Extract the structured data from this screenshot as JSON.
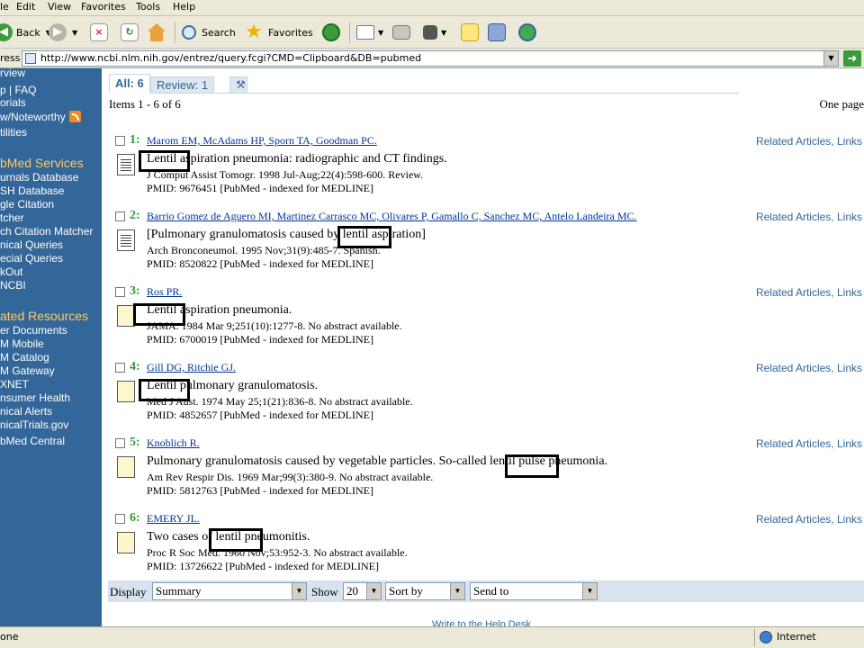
{
  "menu": [
    "le",
    "Edit",
    "View",
    "Favorites",
    "Tools",
    "Help"
  ],
  "toolbar": {
    "back": "Back",
    "search": "Search",
    "favorites": "Favorites"
  },
  "address": {
    "label": "ress",
    "url": "http://www.ncbi.nlm.nih.gov/entrez/query.fcgi?CMD=Clipboard&DB=pubmed"
  },
  "sidebar": {
    "items": [
      {
        "label": "rview",
        "type": "link"
      },
      {
        "label": "p | FAQ",
        "type": "link"
      },
      {
        "label": "orials",
        "type": "link"
      },
      {
        "label": "w/Noteworthy",
        "type": "link"
      },
      {
        "label": "tilities",
        "type": "link"
      },
      {
        "label": "bMed Services",
        "type": "header"
      },
      {
        "label": "urnals Database",
        "type": "link"
      },
      {
        "label": "SH Database",
        "type": "link"
      },
      {
        "label": "gle Citation",
        "type": "link"
      },
      {
        "label": "tcher",
        "type": "link"
      },
      {
        "label": "ch Citation Matcher",
        "type": "link"
      },
      {
        "label": "nical Queries",
        "type": "link"
      },
      {
        "label": "ecial Queries",
        "type": "link"
      },
      {
        "label": "kOut",
        "type": "link"
      },
      {
        "label": "NCBI",
        "type": "link"
      },
      {
        "label": "ated Resources",
        "type": "header"
      },
      {
        "label": "er Documents",
        "type": "link"
      },
      {
        "label": "M Mobile",
        "type": "link"
      },
      {
        "label": "M Catalog",
        "type": "link"
      },
      {
        "label": "M Gateway",
        "type": "link"
      },
      {
        "label": "XNET",
        "type": "link"
      },
      {
        "label": "nsumer Health",
        "type": "link"
      },
      {
        "label": "nical Alerts",
        "type": "link"
      },
      {
        "label": "nicalTrials.gov",
        "type": "link"
      },
      {
        "label": "bMed Central",
        "type": "link"
      }
    ]
  },
  "tabs": {
    "all": "All: 6",
    "review": "Review: 1"
  },
  "results": {
    "items_label": "Items 1 - 6 of 6",
    "page_label": "One page",
    "related_label": "Related Articles, Links",
    "records": [
      {
        "num": "1:",
        "authors": "Marom EM, McAdams HP, Sporn TA, Goodman PC.",
        "title": "Lentil aspiration pneumonia: radiographic and CT findings.",
        "source": "J Comput Assist Tomogr. 1998 Jul-Aug;22(4):598-600. Review.",
        "pmid": "PMID: 9676451 [PubMed - indexed for MEDLINE]",
        "icon": "abstract-icon"
      },
      {
        "num": "2:",
        "authors": "Barrio Gomez de Aguero MI, Martinez Carrasco MC, Olivares P, Gamallo C, Sanchez MC, Antelo Landeira MC.",
        "title": "[Pulmonary granulomatosis caused by lentil aspiration]",
        "source": "Arch Bronconeumol. 1995 Nov;31(9):485-7. Spanish.",
        "pmid": "PMID: 8520822 [PubMed - indexed for MEDLINE]",
        "icon": "abstract-icon"
      },
      {
        "num": "3:",
        "authors": "Ros PR.",
        "title": "Lentil aspiration pneumonia.",
        "source": "JAMA. 1984 Mar 9;251(10):1277-8. No abstract available.",
        "pmid": "PMID: 6700019 [PubMed - indexed for MEDLINE]",
        "icon": "no-abstract-icon"
      },
      {
        "num": "4:",
        "authors": "Gill DG, Ritchie GJ.",
        "title": "Lentil pulmonary granulomatosis.",
        "source": "Med J Aust. 1974 May 25;1(21):836-8. No abstract available.",
        "pmid": "PMID: 4852657 [PubMed - indexed for MEDLINE]",
        "icon": "no-abstract-icon"
      },
      {
        "num": "5:",
        "authors": "Knoblich R.",
        "title": "Pulmonary granulomatosis caused by vegetable particles. So-called lentil pulse pneumonia.",
        "source": "Am Rev Respir Dis. 1969 Mar;99(3):380-9. No abstract available.",
        "pmid": "PMID: 5812763 [PubMed - indexed for MEDLINE]",
        "icon": "no-abstract-icon"
      },
      {
        "num": "6:",
        "authors": "EMERY JL.",
        "title": "Two cases of lentil pneumonitis.",
        "source": "Proc R Soc Med. 1960 Nov;53:952-3. No abstract available.",
        "pmid": "PMID: 13726622 [PubMed - indexed for MEDLINE]",
        "icon": "no-abstract-icon"
      }
    ]
  },
  "display_bar": {
    "display_label": "Display",
    "format_value": "Summary",
    "show_label": "Show",
    "show_value": "20",
    "sort_value": "Sort by",
    "send_value": "Send to"
  },
  "footer": {
    "link": "Write to the Help Desk"
  },
  "status": {
    "left": "one",
    "zone": "Internet"
  },
  "colors": {
    "sidebar_bg": "#336699",
    "record_number": "#339933",
    "link": "#003399",
    "display_bar_bg": "#d9e3ef"
  }
}
